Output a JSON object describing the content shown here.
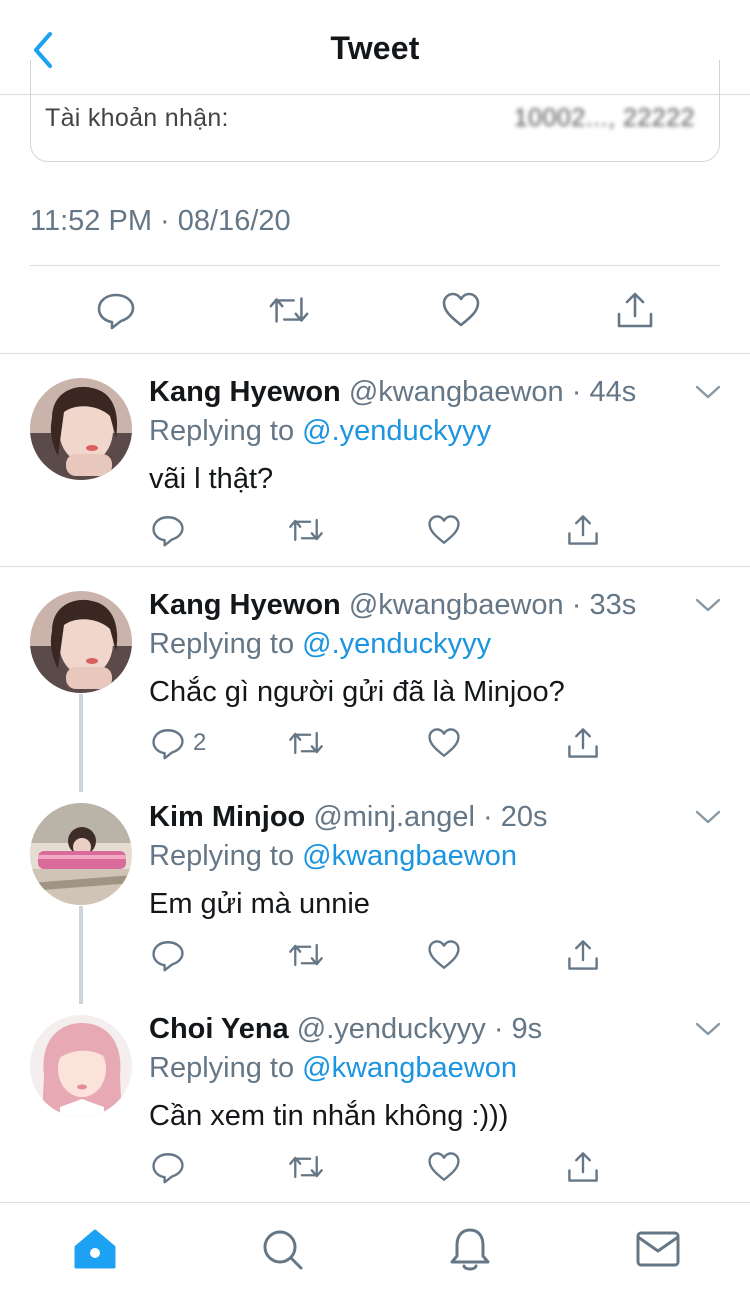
{
  "header": {
    "title": "Tweet"
  },
  "card": {
    "label": "Tài khoản nhận:",
    "value": "10002..., 22222"
  },
  "tweet": {
    "timestamp": "11:52 PM · 08/16/20"
  },
  "replies": [
    {
      "name": "Kang Hyewon",
      "handle": "@kwangbaewon",
      "time": "· 44s",
      "replying_prefix": "Replying to",
      "replying_to": "@.yenduckyyy",
      "text": "vãi l thật?",
      "reply_count": ""
    },
    {
      "name": "Kang Hyewon",
      "handle": "@kwangbaewon",
      "time": "· 33s",
      "replying_prefix": "Replying to",
      "replying_to": "@.yenduckyyy",
      "text": "Chắc gì người gửi đã là Minjoo?",
      "reply_count": "2"
    },
    {
      "name": "Kim Minjoo",
      "handle": "@minj.angel",
      "time": "· 20s",
      "replying_prefix": "Replying to",
      "replying_to": "@kwangbaewon",
      "text": "Em gửi mà unnie",
      "reply_count": ""
    },
    {
      "name": "Choi Yena",
      "handle": "@.yenduckyyy",
      "time": "· 9s",
      "replying_prefix": "Replying to",
      "replying_to": "@kwangbaewon",
      "text": "Cần xem tin nhắn không :)))",
      "reply_count": ""
    }
  ],
  "icons": {
    "back": "chevron-left-icon",
    "reply": "comment-icon",
    "retweet": "retweet-icon",
    "like": "heart-icon",
    "share": "share-icon",
    "caret": "chevron-down-icon",
    "home": "home-icon",
    "search": "search-icon",
    "notifications": "bell-icon",
    "messages": "mail-icon"
  },
  "colors": {
    "accent": "#1da1f2",
    "icon_gray": "#657786",
    "link": "#1b95e0",
    "divider": "#d9dde1"
  }
}
